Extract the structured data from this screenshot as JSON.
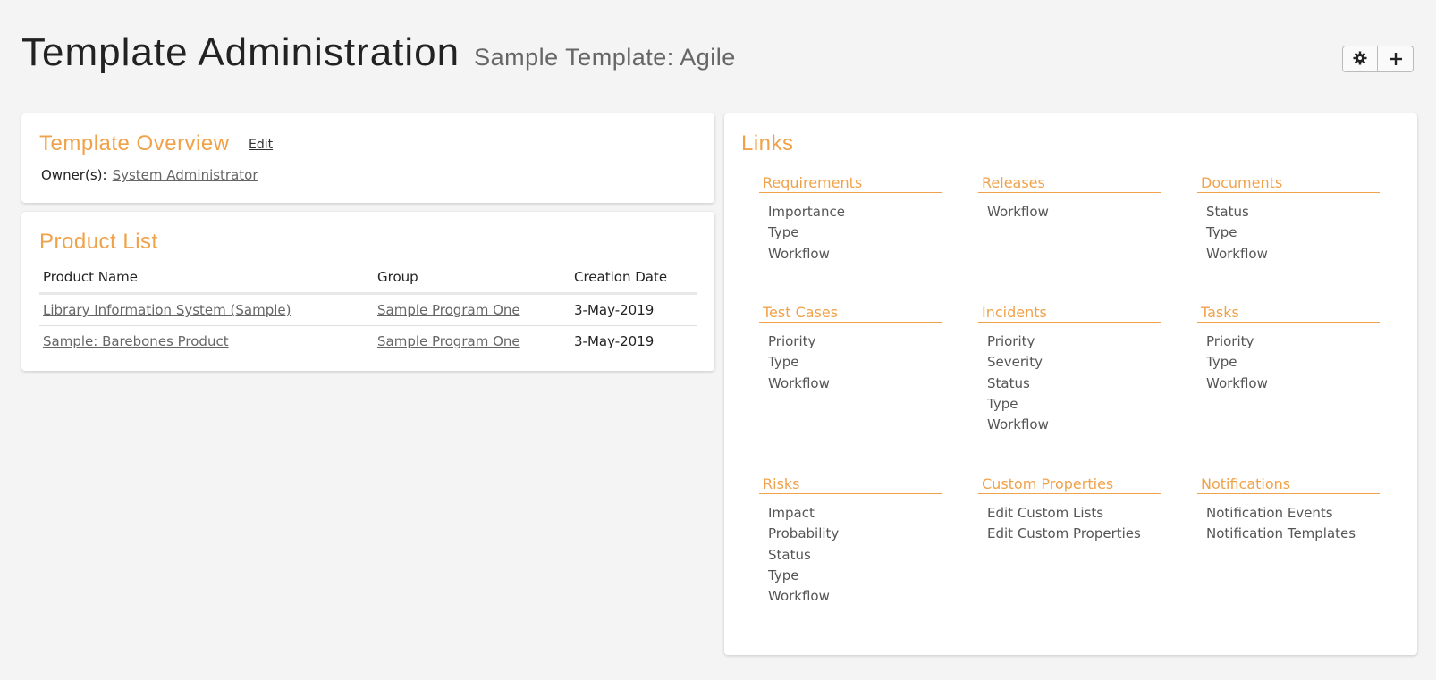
{
  "header": {
    "title": "Template Administration",
    "subtitle": "Sample Template: Agile"
  },
  "toolbar": {
    "settings_icon": "gear-icon",
    "add_icon": "plus-icon"
  },
  "overview": {
    "title": "Template Overview",
    "edit_label": "Edit",
    "owner_label": "Owner(s):",
    "owner_value": "System Administrator"
  },
  "product_list": {
    "title": "Product List",
    "columns": [
      "Product Name",
      "Group",
      "Creation Date"
    ],
    "rows": [
      {
        "name": "Library Information System (Sample)",
        "group": "Sample Program One",
        "date": "3-May-2019"
      },
      {
        "name": "Sample: Barebones Product",
        "group": "Sample Program One",
        "date": "3-May-2019"
      }
    ]
  },
  "links": {
    "title": "Links",
    "groups": [
      {
        "title": "Requirements",
        "items": [
          "Importance",
          "Type",
          "Workflow"
        ]
      },
      {
        "title": "Releases",
        "items": [
          "Workflow"
        ]
      },
      {
        "title": "Documents",
        "items": [
          "Status",
          "Type",
          "Workflow"
        ]
      },
      {
        "title": "Test Cases",
        "items": [
          "Priority",
          "Type",
          "Workflow"
        ]
      },
      {
        "title": "Incidents",
        "items": [
          "Priority",
          "Severity",
          "Status",
          "Type",
          "Workflow"
        ]
      },
      {
        "title": "Tasks",
        "items": [
          "Priority",
          "Type",
          "Workflow"
        ]
      },
      {
        "title": "Risks",
        "items": [
          "Impact",
          "Probability",
          "Status",
          "Type",
          "Workflow"
        ]
      },
      {
        "title": "Custom Properties",
        "items": [
          "Edit Custom Lists",
          "Edit Custom Properties"
        ]
      },
      {
        "title": "Notifications",
        "items": [
          "Notification Events",
          "Notification Templates"
        ]
      }
    ]
  },
  "colors": {
    "accent": "#f0a24a",
    "background": "#f4f4f4"
  }
}
